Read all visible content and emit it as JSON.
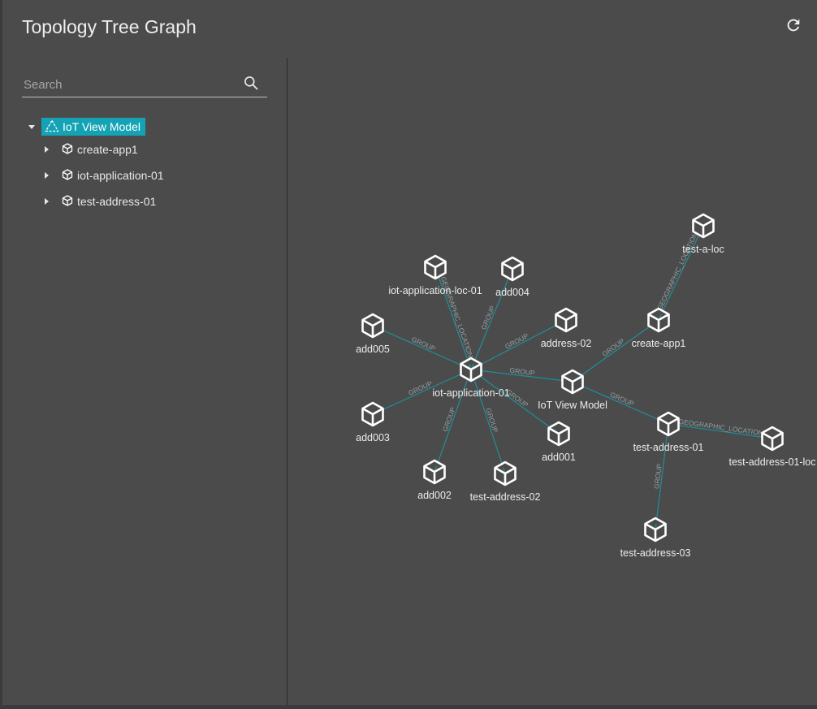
{
  "header": {
    "title": "Topology Tree Graph",
    "refresh_icon": "refresh-icon"
  },
  "search": {
    "placeholder": "Search",
    "value": "",
    "icon": "search-icon"
  },
  "tree": {
    "root": {
      "label": "IoT View Model",
      "icon": "model-icon",
      "expanded": true,
      "selected": true
    },
    "children": [
      {
        "label": "create-app1",
        "icon": "cube-icon",
        "expanded": false
      },
      {
        "label": "iot-application-01",
        "icon": "cube-icon",
        "expanded": false
      },
      {
        "label": "test-address-01",
        "icon": "cube-icon",
        "expanded": false
      }
    ]
  },
  "graph": {
    "colors": {
      "edge": "#1f8f99",
      "edge_label": "#8fa0a3",
      "node": "#ffffff",
      "selected": "#14a3b5"
    },
    "nodes": [
      {
        "id": "test-a-loc",
        "label": "test-a-loc"
      },
      {
        "id": "iot-application-loc-01",
        "label": "iot-application-loc-01"
      },
      {
        "id": "add004",
        "label": "add004"
      },
      {
        "id": "add005",
        "label": "add005"
      },
      {
        "id": "address-02",
        "label": "address-02"
      },
      {
        "id": "create-app1",
        "label": "create-app1"
      },
      {
        "id": "iot-application-01",
        "label": "iot-application-01"
      },
      {
        "id": "iot-view-model",
        "label": "IoT View Model"
      },
      {
        "id": "add003",
        "label": "add003"
      },
      {
        "id": "add001",
        "label": "add001"
      },
      {
        "id": "test-address-01",
        "label": "test-address-01"
      },
      {
        "id": "test-address-01-loc",
        "label": "test-address-01-loc"
      },
      {
        "id": "add002",
        "label": "add002"
      },
      {
        "id": "test-address-02",
        "label": "test-address-02"
      },
      {
        "id": "test-address-03",
        "label": "test-address-03"
      }
    ],
    "edges": [
      {
        "from": "iot-application-01",
        "to": "iot-application-loc-01",
        "label": "GEOGRAPHIC_LOCATION"
      },
      {
        "from": "iot-application-01",
        "to": "add004",
        "label": "GROUP"
      },
      {
        "from": "iot-application-01",
        "to": "add005",
        "label": "GROUP"
      },
      {
        "from": "iot-application-01",
        "to": "address-02",
        "label": "GROUP"
      },
      {
        "from": "iot-application-01",
        "to": "iot-view-model",
        "label": "GROUP"
      },
      {
        "from": "iot-application-01",
        "to": "add003",
        "label": "GROUP"
      },
      {
        "from": "iot-application-01",
        "to": "add002",
        "label": "GROUP"
      },
      {
        "from": "iot-application-01",
        "to": "test-address-02",
        "label": "GROUP"
      },
      {
        "from": "iot-application-01",
        "to": "add001",
        "label": "GROUP"
      },
      {
        "from": "iot-view-model",
        "to": "create-app1",
        "label": "GROUP"
      },
      {
        "from": "iot-view-model",
        "to": "test-address-01",
        "label": "GROUP"
      },
      {
        "from": "create-app1",
        "to": "test-a-loc",
        "label": "GEOGRAPHIC_LOCATION"
      },
      {
        "from": "test-address-01",
        "to": "test-address-01-loc",
        "label": "GEOGRAPHIC_LOCATION"
      },
      {
        "from": "test-address-01",
        "to": "test-address-03",
        "label": "GROUP"
      }
    ]
  }
}
